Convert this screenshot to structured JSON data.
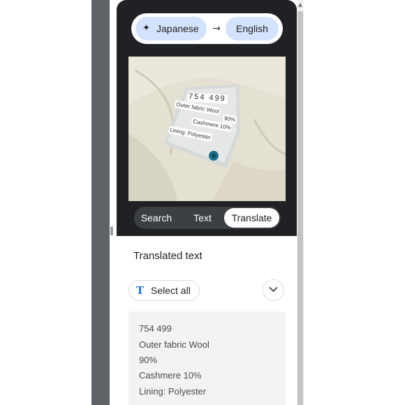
{
  "language_selector": {
    "source_icon": "sparkle-icon",
    "source_language": "Japanese",
    "arrow_icon": "arrow-right-icon",
    "target_language": "English"
  },
  "photo_overlay": {
    "lines": [
      "754 499",
      "Outer fabric Wool",
      "90%",
      "Cashmere 10%",
      "Lining: Polyester"
    ]
  },
  "tabs": {
    "search": "Search",
    "text": "Text",
    "translate": "Translate",
    "active": "Translate"
  },
  "result": {
    "title": "Translated text",
    "select_all_icon": "text-format-icon",
    "select_all_label": "Select all",
    "expand_icon": "chevron-down-icon",
    "lines": [
      "754 499",
      "Outer fabric Wool",
      "90%",
      "Cashmere 10%",
      "Lining: Polyester"
    ]
  },
  "colors": {
    "panel_dark": "#202124",
    "chip_blue": "#d3e3fd",
    "accent_blue": "#1a73e8"
  }
}
